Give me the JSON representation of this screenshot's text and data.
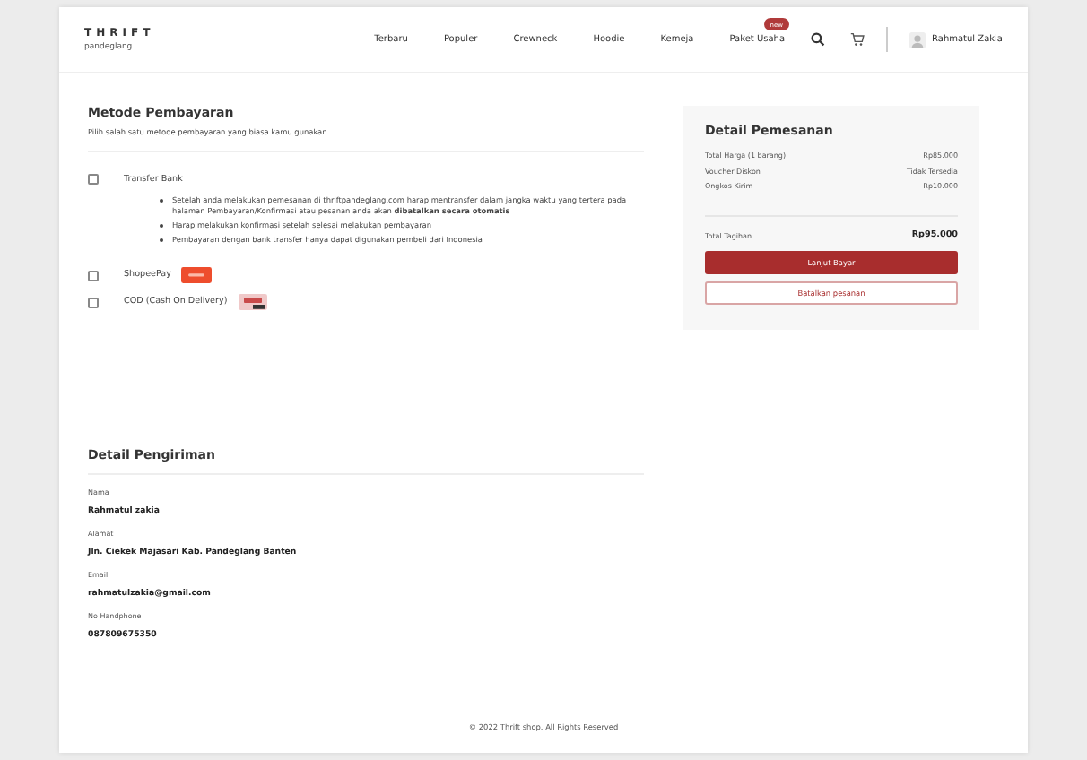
{
  "header": {
    "logo_title": "THRIFT",
    "logo_subtitle": "pandeglang",
    "nav": [
      {
        "label": "Terbaru"
      },
      {
        "label": "Populer"
      },
      {
        "label": "Crewneck"
      },
      {
        "label": "Hoodie"
      },
      {
        "label": "Kemeja"
      },
      {
        "label": "Paket Usaha",
        "badge": "new"
      }
    ],
    "user_name": "Rahmatul Zakia"
  },
  "payment": {
    "title": "Metode Pembayaran",
    "subtitle": "Pilih salah satu metode pembayaran yang biasa kamu gunakan",
    "methods": [
      {
        "kind": "bank",
        "label": "Transfer Bank",
        "checked": false,
        "notes": [
          "Setelah anda melakukan pemesanan di thriftpandeglang.com harap mentransfer dalam jangka waktu yang tertera pada halaman Pembayaran/Konfirmasi atau pesanan anda akan **dibatalkan secara otomatis**",
          "Harap melakukan konfirmasi setelah selesai melakukan pembayaran",
          "Pembayaran dengan bank transfer hanya dapat digunakan pembeli dari Indonesia"
        ]
      },
      {
        "kind": "shopeepay",
        "label": "ShopeePay",
        "checked": false
      },
      {
        "kind": "cod",
        "label": "COD (Cash On Delivery)",
        "checked": false
      }
    ]
  },
  "order": {
    "title": "Detail Pemesanan",
    "rows": [
      {
        "label": "Total Harga (1 barang)",
        "value": "Rp85.000"
      },
      {
        "label": "Voucher Diskon",
        "value": "Tidak Tersedia"
      },
      {
        "label": "Ongkos Kirim",
        "value": "Rp10.000"
      }
    ],
    "total": {
      "label": "Total Tagihan",
      "value": "Rp95.000"
    },
    "buttons": [
      {
        "kind": "primary",
        "label": "Lanjut Bayar"
      },
      {
        "kind": "outline",
        "label": "Batalkan pesanan"
      }
    ]
  },
  "shipping": {
    "title": "Detail Pengiriman",
    "fields": [
      {
        "label": "Nama",
        "value": "Rahmatul zakia"
      },
      {
        "label": "Alamat",
        "value": "Jln. Ciekek Majasari Kab. Pandeglang Banten"
      },
      {
        "label": "Email",
        "value": "rahmatulzakia@gmail.com"
      },
      {
        "label": "No Handphone",
        "value": "087809675350"
      }
    ]
  },
  "footer": "© 2022 Thrift shop. All Rights Reserved"
}
